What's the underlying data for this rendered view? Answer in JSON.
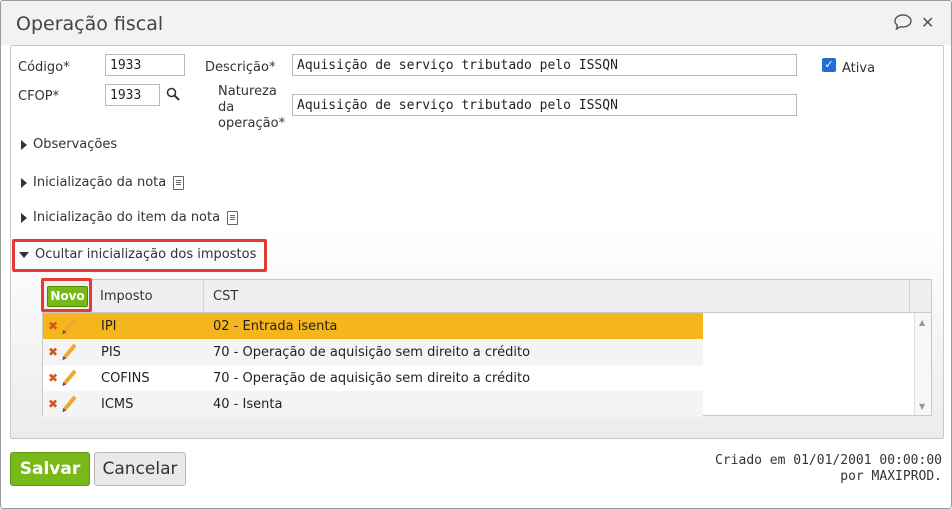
{
  "dialog": {
    "title": "Operação fiscal",
    "chat_icon": "speech-bubble-icon",
    "close_icon": "close-icon",
    "close_glyph": "✕"
  },
  "form": {
    "codigo_label": "Código*",
    "codigo_value": "1933",
    "cfop_label": "CFOP*",
    "cfop_value": "1933",
    "descricao_label": "Descrição*",
    "descricao_value": "Aquisição de serviço tributado pelo ISSQN",
    "natureza_label_1": "Natureza",
    "natureza_label_2": "da",
    "natureza_label_3": "operação*",
    "natureza_value": "Aquisição de serviço tributado pelo ISSQN",
    "ativa_label": "Ativa",
    "ativa_checked": true
  },
  "sections": {
    "observacoes": "Observações",
    "inicializacao_nota": "Inicialização da nota",
    "inicializacao_item": "Inicialização do item da nota",
    "ocultar_impostos": "Ocultar inicialização dos impostos"
  },
  "grid": {
    "novo_label": "Novo",
    "columns": [
      "Imposto",
      "CST"
    ],
    "rows": [
      {
        "imposto": "IPI",
        "cst": "02 - Entrada isenta",
        "selected": true
      },
      {
        "imposto": "PIS",
        "cst": "70 - Operação de aquisição sem direito a crédito",
        "selected": false
      },
      {
        "imposto": "COFINS",
        "cst": "70 - Operação de aquisição sem direito a crédito",
        "selected": false
      },
      {
        "imposto": "ICMS",
        "cst": "40 - Isenta",
        "selected": false
      }
    ]
  },
  "footer": {
    "save_label": "Salvar",
    "cancel_label": "Cancelar",
    "created_line1": "Criado em 01/01/2001 00:00:00",
    "created_line2": "por MAXIPROD."
  },
  "colors": {
    "selected_row": "#f5b51c",
    "stripe_row": "#f4f4f4",
    "primary_green": "#78b919",
    "highlight_red": "#e53935",
    "checkbox_blue": "#1f6fd6"
  }
}
